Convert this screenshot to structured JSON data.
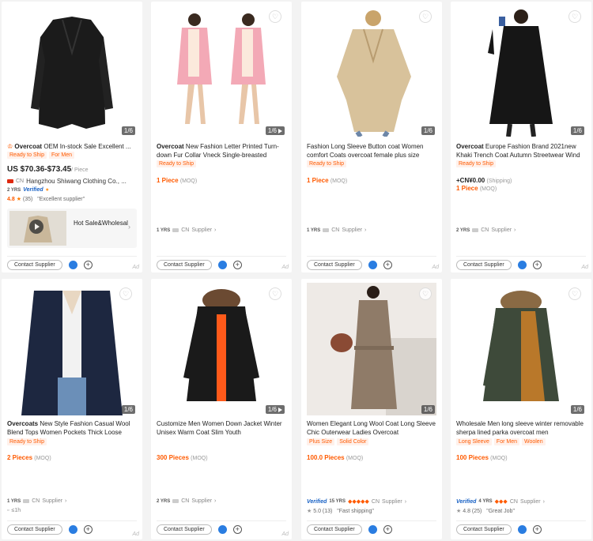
{
  "products": [
    {
      "title_bold": "Overcoat",
      "title_rest": " OEM In-stock Sale Excellent ...",
      "counter": "1/6",
      "has_video": false,
      "tags": [
        "Ready to Ship",
        "For Men"
      ],
      "price": "US $70.36-$73.45",
      "price_unit": "/ Piece",
      "supplier_country": "CN",
      "company": "Hangzhou Shiwang Clothing Co., ...",
      "years": "2 YRS",
      "verified_label": "Verified",
      "rating_score": "4.8",
      "rating_count": "(35)",
      "review": "\"Excellent supplier\"",
      "hot_label": "Hot Sale&Wholesal",
      "contact_label": "Contact Supplier",
      "ad_label": "Ad"
    },
    {
      "title_bold": "Overcoat",
      "title_rest": " New Fashion Letter Printed Turn-down Fur Collar Vneck Single-breasted",
      "counter": "1/6",
      "has_video": true,
      "tags": [
        "Ready to Ship"
      ],
      "moq_value": "1 Piece",
      "moq_label": "(MOQ)",
      "years": "1 YRS",
      "supplier_country": "CN",
      "supplier_label": "Supplier",
      "contact_label": "Contact Supplier",
      "ad_label": "Ad"
    },
    {
      "title_bold": "",
      "title_rest": "Fashion Long Sleeve Button coat Women comfort Coats overcoat female plus size",
      "counter": "1/6",
      "has_video": false,
      "tags": [
        "Ready to Ship"
      ],
      "moq_value": "1 Piece",
      "moq_label": "(MOQ)",
      "years": "1 YRS",
      "supplier_country": "CN",
      "supplier_label": "Supplier",
      "contact_label": "Contact Supplier",
      "ad_label": "Ad"
    },
    {
      "title_bold": "Overcoat",
      "title_rest": " Europe Fashion Brand 2021new Khaki Trench Coat Autumn Streetwear Wind",
      "counter": "1/6",
      "has_video": false,
      "tags": [
        "Ready to Ship"
      ],
      "shipping_value": "+CN¥0.00",
      "shipping_label": "(Shipping)",
      "moq_value": "1 Piece",
      "moq_label": "(MOQ)",
      "years": "2 YRS",
      "supplier_country": "CN",
      "supplier_label": "Supplier",
      "contact_label": "Contact Supplier",
      "ad_label": "Ad"
    },
    {
      "title_bold": "Overcoats",
      "title_rest": " New Style Fashion Casual Wool Blend Tops Women Pockets Thick Loose",
      "counter": "1/6",
      "has_video": false,
      "tags": [
        "Ready to Ship"
      ],
      "moq_value": "2 Pieces",
      "moq_label": "(MOQ)",
      "years": "1 YRS",
      "supplier_country": "CN",
      "supplier_label": "Supplier",
      "extra": "≤1h",
      "contact_label": "Contact Supplier",
      "ad_label": "Ad"
    },
    {
      "title_bold": "",
      "title_rest": "Customize Men Women Down Jacket Winter Unisex Warm Coat Slim Youth",
      "counter": "1/6",
      "has_video": true,
      "tags": [],
      "moq_value": "300 Pieces",
      "moq_label": "(MOQ)",
      "years": "2 YRS",
      "supplier_country": "CN",
      "supplier_label": "Supplier",
      "contact_label": "Contact Supplier",
      "ad_label": "Ad"
    },
    {
      "title_bold": "",
      "title_rest": "Women Elegant Long Wool Coat Long Sleeve Chic Outerwear Ladies Overcoat",
      "counter": "1/6",
      "has_video": false,
      "tags": [
        "Plus Size",
        "Solid Color"
      ],
      "moq_value": "100.0 Pieces",
      "moq_label": "(MOQ)",
      "verified_label": "Verified",
      "years": "15 YRS",
      "diamonds": "◆◆◆◆◆",
      "supplier_country": "CN",
      "supplier_label": "Supplier",
      "rating_score": "5.0",
      "rating_count": "(13)",
      "review": "\"Fast shipping\"",
      "contact_label": "Contact Supplier",
      "ad_label": ""
    },
    {
      "title_bold": "",
      "title_rest": "Wholesale Men long sleeve winter removable sherpa lined parka overcoat men",
      "counter": "1/6",
      "has_video": false,
      "tags": [
        "Long Sleeve",
        "For Men",
        "Woolen"
      ],
      "moq_value": "100 Pieces",
      "moq_label": "(MOQ)",
      "verified_label": "Verified",
      "years": "4 YRS",
      "diamonds": "◆◆◆",
      "supplier_country": "CN",
      "supplier_label": "Supplier",
      "rating_score": "4.8",
      "rating_count": "(25)",
      "review": "\"Great Job\"",
      "contact_label": "Contact Supplier",
      "ad_label": ""
    }
  ],
  "colors": {
    "accent": "#ff5a00",
    "verified": "#1660c4",
    "chat": "#2a7de1"
  },
  "icons": {
    "favorite": "heart-icon",
    "chat": "chat-icon",
    "add": "plus-icon",
    "video": "play-icon",
    "arrow": "chevron-right-icon"
  }
}
